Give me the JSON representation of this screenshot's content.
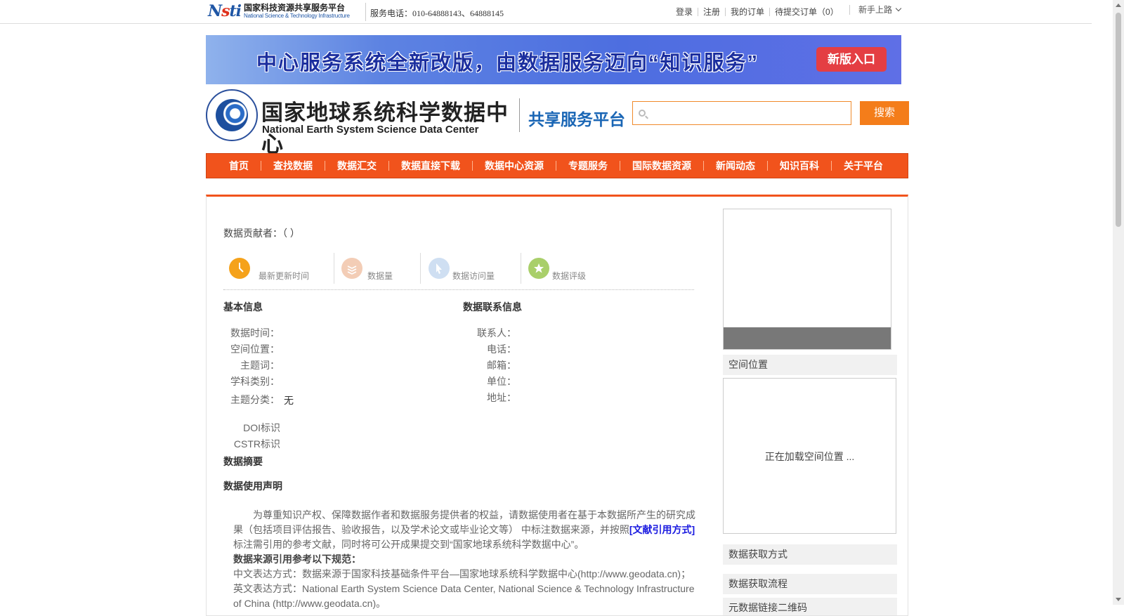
{
  "topbar": {
    "logo_cn": "国家科技资源共享服务平台",
    "logo_en": "National Science & Technology Infrastructure",
    "hotline": "服务电话：010-64888143、64888145",
    "links": [
      "登录",
      "注册",
      "我的订单",
      "待提交订单（0）"
    ],
    "guide": "新手上路"
  },
  "banner": {
    "text": "中心服务系统全新改版，由数据服务迈向“知识服务”",
    "button": "新版入口"
  },
  "header": {
    "center_cn": "国家地球系统科学数据中心",
    "center_en": "National Earth System Science Data Center",
    "platform": "共享服务平台",
    "search_placeholder": "",
    "search_button": "搜索"
  },
  "nav": [
    "首页",
    "查找数据",
    "数据汇交",
    "数据直接下载",
    "数据中心资源",
    "专题服务",
    "国际数据资源",
    "新闻动态",
    "知识百科",
    "关于平台"
  ],
  "detail": {
    "contributor": "数据贡献者：（ ）",
    "stats": [
      {
        "label": "最新更新时间",
        "icon": "clock-icon",
        "color": "#f5a21b"
      },
      {
        "label": "数据量",
        "icon": "layers-icon",
        "color": "#f3cdb6"
      },
      {
        "label": "数据访问量",
        "icon": "cursor-icon",
        "color": "#cfdff2"
      },
      {
        "label": "数据评级",
        "icon": "star-icon",
        "color": "#a9cf6a"
      }
    ],
    "basic_title": "基本信息",
    "basic_fields": [
      "数据时间：",
      "空间位置：",
      "主题词：",
      "学科类别：",
      "主题分类："
    ],
    "topic_value": "无",
    "doi_label": "DOI标识",
    "cstr_label": "CSTR标识",
    "contact_title": "数据联系信息",
    "contact_fields": [
      "联系人：",
      "电话：",
      "邮箱：",
      "单位：",
      "地址："
    ],
    "abstract_title": "数据摘要",
    "usage_title": "数据使用声明",
    "usage_p1": "为尊重知识产权、保障数据作者和数据服务提供者的权益，请数据使用者在基于本数据所产生的研究成果（包括项目评估报告、验收报告，以及学术论文或毕业论文等） 中标注数据来源，并按照",
    "usage_link": "[文献引用方式]",
    "usage_p1b": "标注需引用的参考文献，同时将可公开成果提交到“国家地球系统科学数据中心”。",
    "usage_h": "数据来源引用参考以下规范：",
    "usage_cn": "中文表达方式：数据来源于国家科技基础条件平台—国家地球系统科学数据中心(http://www.geodata.cn)；",
    "usage_en": "英文表达方式：National Earth System Science Data Center, National Science & Technology Infrastructure of China (http://www.geodata.cn)。"
  },
  "sidebar": {
    "spatial": "空间位置",
    "map_loading": "正在加载空间位置 ...",
    "access": "数据获取方式",
    "flow": "数据获取流程",
    "qrcode": "元数据链接二维码"
  }
}
